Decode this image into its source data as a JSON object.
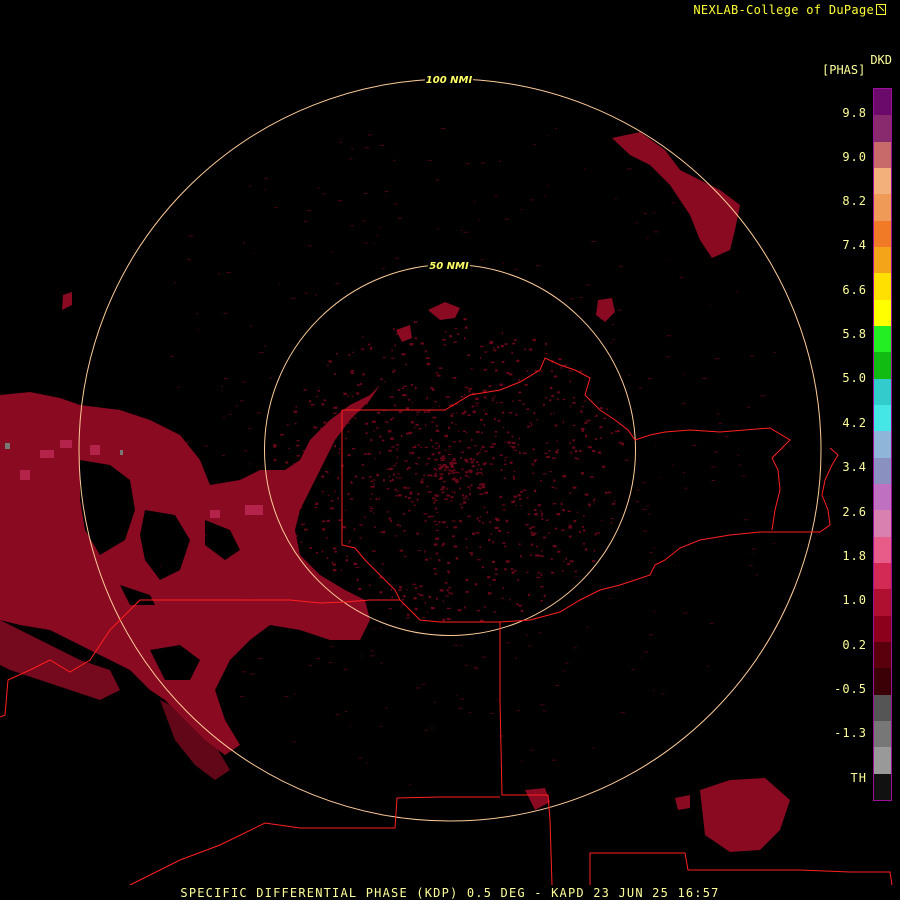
{
  "credit": "NEXLAB-College of DuPage",
  "product_code": "DKD",
  "unit": "[PHAS]",
  "range_rings": [
    "100 NMI",
    "50 NMI"
  ],
  "footer": "SPECIFIC DIFFERENTIAL PHASE (KDP) 0.5 DEG - KAPD 23 JUN 25 16:57",
  "legend": {
    "ticks": [
      "9.8",
      "9.0",
      "8.2",
      "7.4",
      "6.6",
      "5.8",
      "5.0",
      "4.2",
      "3.4",
      "2.6",
      "1.8",
      "1.0",
      "0.2",
      "-0.5",
      "-1.3",
      "TH"
    ],
    "colors": [
      "#6b0a6b",
      "#8a2a6e",
      "#c86a6a",
      "#f4b07a",
      "#f09a58",
      "#f07a26",
      "#f4a418",
      "#ffe000",
      "#ffff00",
      "#22ee22",
      "#11bb11",
      "#33cccc",
      "#44e6e6",
      "#8fb6d8",
      "#8a90c0",
      "#c070c0",
      "#d880b0",
      "#e85c8a",
      "#d22a55",
      "#b01030",
      "#8c001c",
      "#5a000d",
      "#3a0006",
      "#555555",
      "#777777",
      "#999999",
      "#111111"
    ],
    "icon": "external-link-icon"
  },
  "echo_color": "#8a0a22",
  "boundary_color": "#ff2020",
  "ring_color": "#ffcc99"
}
